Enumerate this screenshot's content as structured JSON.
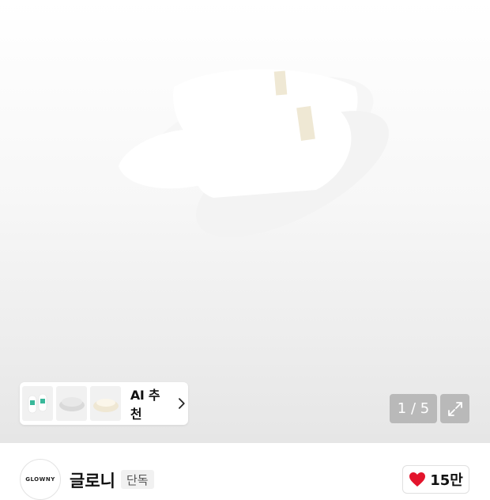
{
  "gallery": {
    "ai_recommend_label": "AI 추천",
    "page_counter": "1 / 5"
  },
  "brand": {
    "logo_text": "GLOWNY",
    "name": "글로니",
    "badge": "단독"
  },
  "likes": {
    "count": "15만",
    "heart_color": "#e3142c"
  },
  "icons": [
    "chevron-right-icon",
    "expand-icon",
    "heart-icon"
  ]
}
